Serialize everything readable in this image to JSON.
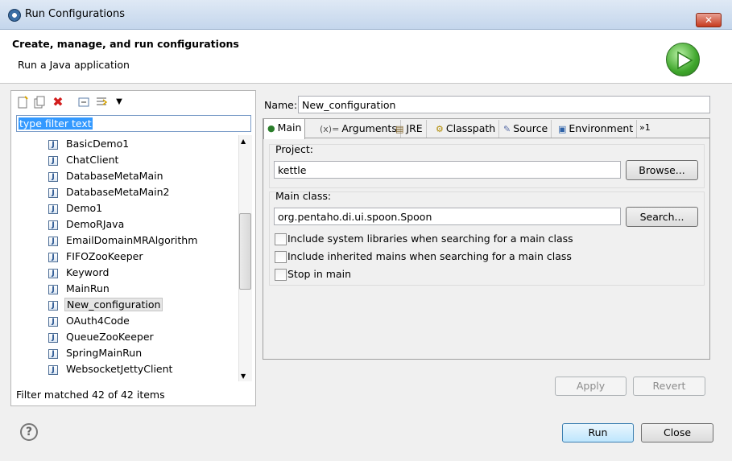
{
  "window": {
    "title": "Run Configurations",
    "close": "✕"
  },
  "banner": {
    "heading": "Create, manage, and run configurations",
    "subtitle": "Run a Java application"
  },
  "left": {
    "filter_text": "type filter text",
    "items": [
      "BasicDemo1",
      "ChatClient",
      "DatabaseMetaMain",
      "DatabaseMetaMain2",
      "Demo1",
      "DemoRJava",
      "EmailDomainMRAlgorithm",
      "FIFOZooKeeper",
      "Keyword",
      "MainRun",
      "New_configuration",
      "OAuth4Code",
      "QueueZooKeeper",
      "SpringMainRun",
      "WebsocketJettyClient"
    ],
    "selected": "New_configuration",
    "status": "Filter matched 42 of 42 items"
  },
  "config": {
    "name_label": "Name:",
    "name_value": "New_configuration",
    "tabs": [
      "Main",
      "Arguments",
      "JRE",
      "Classpath",
      "Source",
      "Environment"
    ],
    "tab_overflow": "»1",
    "project_label": "Project:",
    "project_value": "kettle",
    "browse": "Browse...",
    "main_class_label": "Main class:",
    "main_class_value": "org.pentaho.di.ui.spoon.Spoon",
    "search": "Search...",
    "options": [
      "Include system libraries when searching for a main class",
      "Include inherited mains when searching for a main class",
      "Stop in main"
    ]
  },
  "buttons": {
    "apply": "Apply",
    "revert": "Revert",
    "run": "Run",
    "close": "Close",
    "help": "?"
  },
  "colors": {
    "selection": "#3399ff",
    "run_green": "#3fa62c",
    "close_red": "#c63a1e"
  }
}
